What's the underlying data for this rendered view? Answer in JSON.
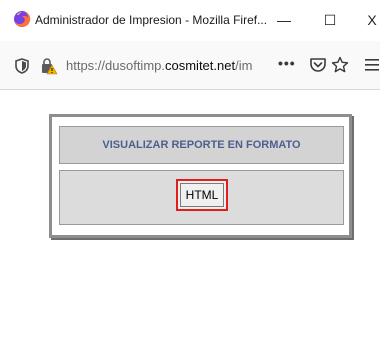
{
  "window": {
    "title": "Administrador de Impresion - Mozilla Firef...",
    "minimize_glyph": "—",
    "maximize_glyph": "☐",
    "close_glyph": "X"
  },
  "navbar": {
    "url_prefix": "https://dusoftimp.",
    "url_domain": "cosmitet.net",
    "url_suffix": "/im",
    "more_glyph": "•••",
    "icons": [
      "shield-icon",
      "lock-warning-icon",
      "pocket-icon",
      "star-icon",
      "hamburger-menu-icon"
    ]
  },
  "page": {
    "header_text": "VISUALIZAR REPORTE EN FORMATO",
    "button_label": "HTML"
  },
  "colors": {
    "header_text": "#4d5f8e",
    "highlight_border": "#e01e1e",
    "firefox_orange": "#ff7139",
    "lock_warning": "#f4b400"
  }
}
